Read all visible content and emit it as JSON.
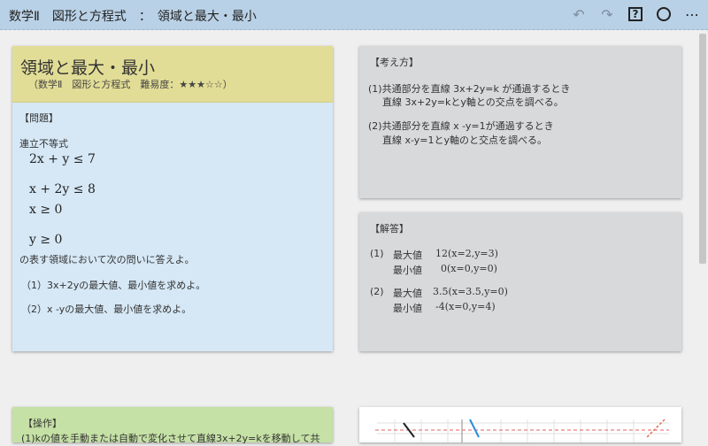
{
  "header": {
    "title": "数学Ⅱ　図形と方程式　：　領域と最大・最小",
    "icons": [
      "undo-icon",
      "redo-icon",
      "help-icon",
      "circle-icon",
      "more-icon"
    ],
    "undo_glyph": "↶",
    "redo_glyph": "↷",
    "help_glyph": "?",
    "more_glyph": "⋯"
  },
  "problem": {
    "title": "領域と最大・最小",
    "subtitle": "（数学Ⅱ　図形と方程式　難易度：★★★☆☆）",
    "section_label": "【問題】",
    "intro": "連立不等式",
    "inequalities": [
      "2x + y ≤ 7",
      "x + 2y ≤ 8",
      "x ≥ 0",
      "y ≥ 0"
    ],
    "region_text": "の表す領域において次の問いに答えよ。",
    "questions": [
      "（1）3x+2yの最大値、最小値を求めよ。",
      "（2）x -yの最大値、最小値を求めよ。"
    ]
  },
  "approach": {
    "label": "【考え方】",
    "lines": [
      "(1)共通部分を直線 3x+2y=k が通過するとき",
      "直線 3x+2y=kとy軸との交点を調べる。",
      "(2)共通部分を直線 x -y=1が通過するとき",
      "直線 x-y=1とy軸のと交点を調べる。"
    ]
  },
  "answer": {
    "label": "【解答】",
    "q1_num": "(1)",
    "q1_max_label": "最大値",
    "q1_max_value": "12(x=2,y=3)",
    "q1_min_label": "最小値",
    "q1_min_value": "0(x=0,y=0)",
    "q2_num": "(2)",
    "q2_max_label": "最大値",
    "q2_max_value": "3.5(x=3.5,y=0)",
    "q2_min_label": "最小値",
    "q2_min_value": "-4(x=0,y=4)"
  },
  "operation": {
    "label": "【操作】",
    "text": "(1)kの値を手動または自動で変化させて直線3x+2y=kを移動して共"
  },
  "colors": {
    "topbar": "#b9d1e6",
    "problem_header": "#e2dd96",
    "problem_body": "#d6e8f6",
    "gray_card": "#d7d9db",
    "operation_card": "#c5e1a5"
  }
}
